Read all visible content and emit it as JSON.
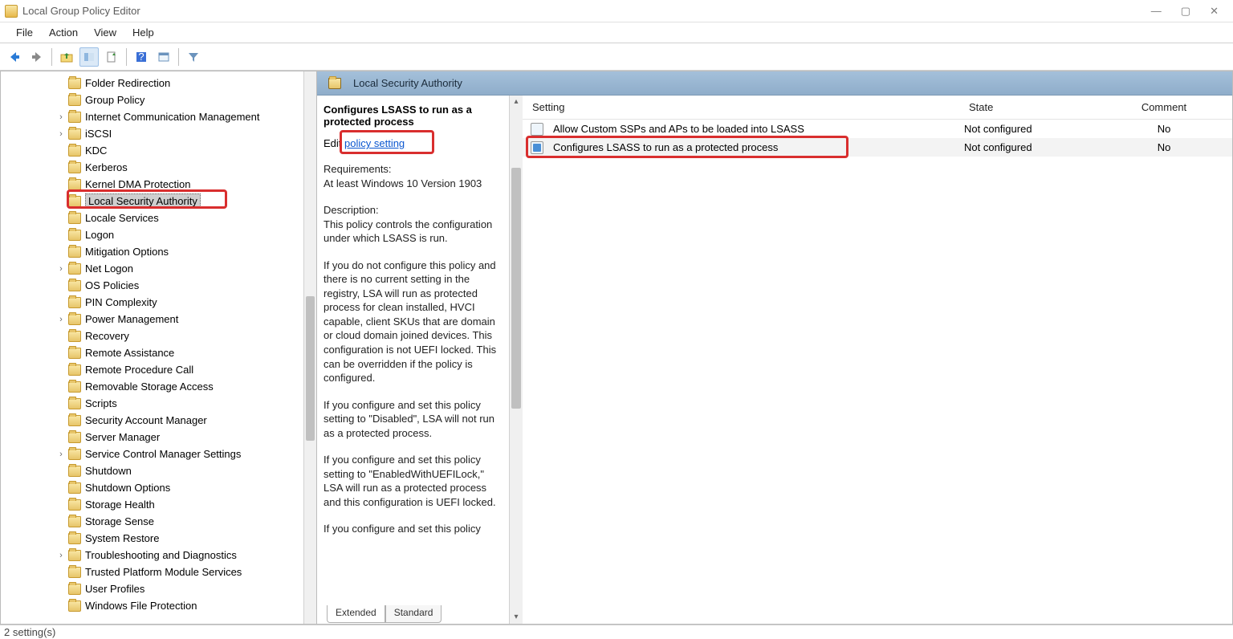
{
  "window": {
    "title": "Local Group Policy Editor"
  },
  "menu": [
    "File",
    "Action",
    "View",
    "Help"
  ],
  "tree": {
    "indent_base": 82,
    "items": [
      {
        "label": "Folder Redirection",
        "exp": ""
      },
      {
        "label": "Group Policy",
        "exp": ""
      },
      {
        "label": "Internet Communication Management",
        "exp": "›"
      },
      {
        "label": "iSCSI",
        "exp": "›"
      },
      {
        "label": "KDC",
        "exp": ""
      },
      {
        "label": "Kerberos",
        "exp": ""
      },
      {
        "label": "Kernel DMA Protection",
        "exp": ""
      },
      {
        "label": "Local Security Authority",
        "exp": "",
        "selected": true
      },
      {
        "label": "Locale Services",
        "exp": ""
      },
      {
        "label": "Logon",
        "exp": ""
      },
      {
        "label": "Mitigation Options",
        "exp": ""
      },
      {
        "label": "Net Logon",
        "exp": "›"
      },
      {
        "label": "OS Policies",
        "exp": ""
      },
      {
        "label": "PIN Complexity",
        "exp": ""
      },
      {
        "label": "Power Management",
        "exp": "›"
      },
      {
        "label": "Recovery",
        "exp": ""
      },
      {
        "label": "Remote Assistance",
        "exp": ""
      },
      {
        "label": "Remote Procedure Call",
        "exp": ""
      },
      {
        "label": "Removable Storage Access",
        "exp": ""
      },
      {
        "label": "Scripts",
        "exp": ""
      },
      {
        "label": "Security Account Manager",
        "exp": ""
      },
      {
        "label": "Server Manager",
        "exp": ""
      },
      {
        "label": "Service Control Manager Settings",
        "exp": "›"
      },
      {
        "label": "Shutdown",
        "exp": ""
      },
      {
        "label": "Shutdown Options",
        "exp": ""
      },
      {
        "label": "Storage Health",
        "exp": ""
      },
      {
        "label": "Storage Sense",
        "exp": ""
      },
      {
        "label": "System Restore",
        "exp": ""
      },
      {
        "label": "Troubleshooting and Diagnostics",
        "exp": "›"
      },
      {
        "label": "Trusted Platform Module Services",
        "exp": ""
      },
      {
        "label": "User Profiles",
        "exp": ""
      },
      {
        "label": "Windows File Protection",
        "exp": ""
      }
    ]
  },
  "main": {
    "path_title": "Local Security Authority",
    "desc": {
      "heading": "Configures LSASS to run as a protected process",
      "edit_prefix": "Edit ",
      "edit_link": "policy setting",
      "req_label": "Requirements:",
      "req_text": "At least Windows 10 Version 1903",
      "desc_label": "Description:",
      "p1": "This policy controls the configuration under which LSASS is run.",
      "p2": "If you do not configure this policy and there is no current setting in the registry, LSA will run as protected process for clean installed, HVCI capable, client SKUs that are domain or cloud domain joined devices. This configuration is not UEFI locked. This can be overridden if the policy is configured.",
      "p3": "If you configure and set this policy setting to \"Disabled\", LSA will not run as a protected process.",
      "p4": "If you configure and set this policy setting to \"EnabledWithUEFILock,\" LSA will run as a protected process and this configuration is UEFI locked.",
      "p5": "If you configure and set this policy"
    },
    "columns": {
      "setting": "Setting",
      "state": "State",
      "comment": "Comment"
    },
    "rows": [
      {
        "setting": "Allow Custom SSPs and APs to be loaded into LSASS",
        "state": "Not configured",
        "comment": "No"
      },
      {
        "setting": "Configures LSASS to run as a protected process",
        "state": "Not configured",
        "comment": "No",
        "highlighted": true
      }
    ],
    "tabs": {
      "extended": "Extended",
      "standard": "Standard"
    }
  },
  "status": "2 setting(s)"
}
